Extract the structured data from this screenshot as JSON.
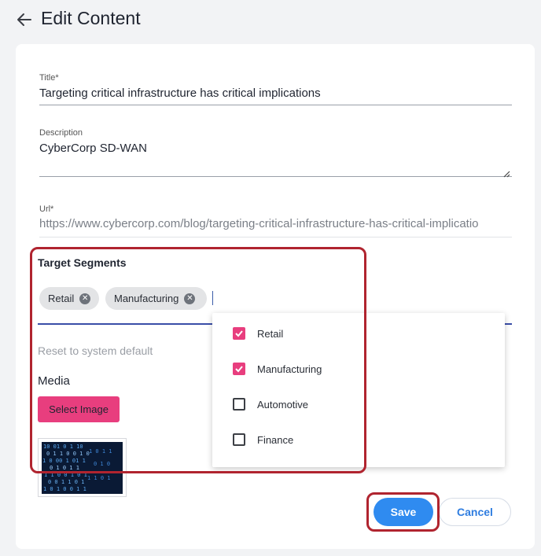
{
  "header": {
    "title": "Edit Content",
    "back_icon": "arrow-left-icon"
  },
  "form": {
    "title_field": {
      "label": "Title*",
      "value": "Targeting critical infrastructure has critical implications"
    },
    "description_field": {
      "label": "Description",
      "value": "CyberCorp SD-WAN"
    },
    "url_field": {
      "label": "Url*",
      "value": "https://www.cybercorp.com/blog/targeting-critical-infrastructure-has-critical-implicatio"
    },
    "target_segments": {
      "label": "Target Segments",
      "chips": [
        {
          "label": "Retail"
        },
        {
          "label": "Manufacturing"
        }
      ],
      "reset_label": "Reset to system default"
    },
    "media": {
      "label": "Media",
      "select_button_label": "Select Image"
    }
  },
  "dropdown": {
    "options": [
      {
        "label": "Retail",
        "checked": true
      },
      {
        "label": "Manufacturing",
        "checked": true
      },
      {
        "label": "Automotive",
        "checked": false
      },
      {
        "label": "Finance",
        "checked": false
      }
    ]
  },
  "actions": {
    "save_label": "Save",
    "cancel_label": "Cancel"
  },
  "colors": {
    "accent_pink": "#e83e7e",
    "primary_blue": "#2f8bf0",
    "highlight_red": "#b0242f"
  }
}
